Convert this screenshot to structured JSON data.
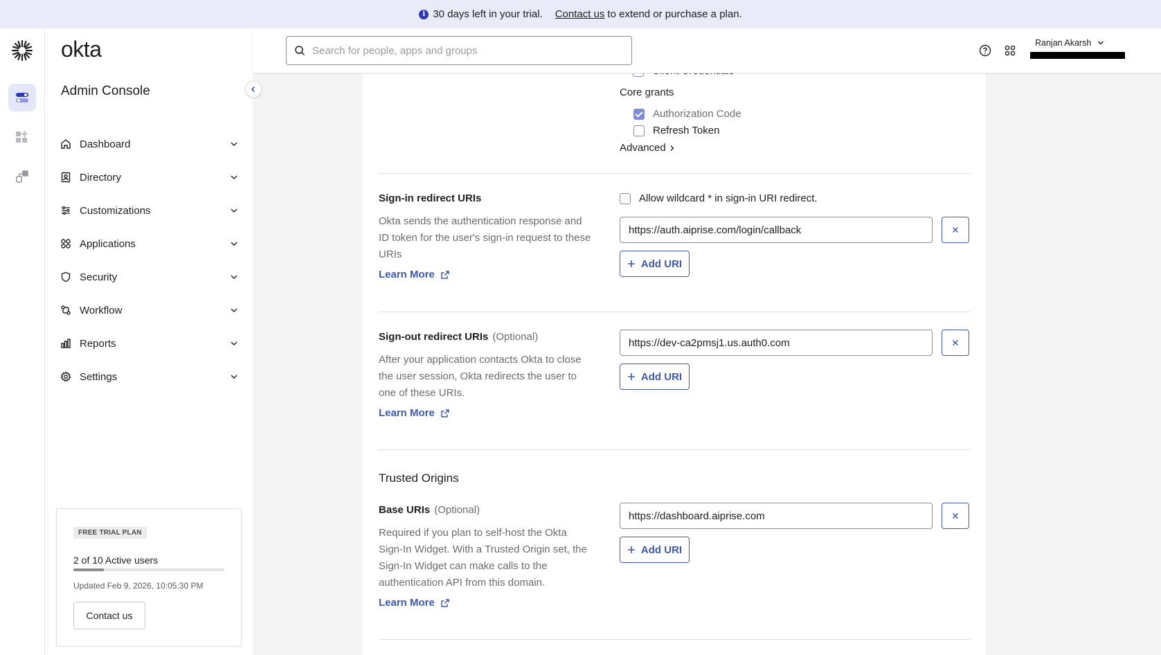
{
  "banner": {
    "message": "30 days left in your trial.",
    "link": "Contact us",
    "suffix": "to extend or purchase a plan."
  },
  "sidebar": {
    "brand": "okta",
    "title": "Admin Console",
    "items": [
      {
        "label": "Dashboard",
        "icon": "home-icon"
      },
      {
        "label": "Directory",
        "icon": "directory-icon"
      },
      {
        "label": "Customizations",
        "icon": "sliders-icon"
      },
      {
        "label": "Applications",
        "icon": "apps-grid-icon"
      },
      {
        "label": "Security",
        "icon": "shield-icon"
      },
      {
        "label": "Workflow",
        "icon": "workflow-icon"
      },
      {
        "label": "Reports",
        "icon": "bar-chart-icon"
      },
      {
        "label": "Settings",
        "icon": "gear-icon"
      }
    ],
    "trial": {
      "badge": "FREE TRIAL PLAN",
      "users": "2 of 10 Active users",
      "users_fraction": 0.2,
      "updated": "Updated Feb 9, 2026, 10:05:30 PM",
      "button": "Contact us"
    }
  },
  "topbar": {
    "search_placeholder": "Search for people, apps and groups",
    "user_name": "Ranjan Akarsh"
  },
  "grants": {
    "cut_label": "Client Credentials",
    "core_label": "Core grants",
    "items": [
      {
        "label": "Authorization Code",
        "checked": true,
        "disabled": true
      },
      {
        "label": "Refresh Token",
        "checked": false,
        "disabled": false
      }
    ],
    "advanced": "Advanced"
  },
  "signin": {
    "title": "Sign-in redirect URIs",
    "description": "Okta sends the authentication response and ID token for the user's sign-in request to these URIs",
    "learn_more": "Learn More",
    "wildcard_label": "Allow wildcard * in sign-in URI redirect.",
    "uri": "https://auth.aiprise.com/login/callback",
    "add_label": "Add URI"
  },
  "signout": {
    "title": "Sign-out redirect URIs",
    "optional": "(Optional)",
    "description": "After your application contacts Okta to close the user session, Okta redirects the user to one of these URIs.",
    "learn_more": "Learn More",
    "uri": "https://dev-ca2pmsj1.us.auth0.com",
    "add_label": "Add URI"
  },
  "trusted": {
    "title": "Trusted Origins",
    "base_title": "Base URIs",
    "optional": "(Optional)",
    "description": "Required if you plan to self-host the Okta Sign-In Widget. With a Trusted Origin set, the Sign-In Widget can make calls to the authentication API from this domain.",
    "learn_more": "Learn More",
    "uri": "https://dashboard.aiprise.com",
    "add_label": "Add URI"
  },
  "colors": {
    "accent": "#3f59a8",
    "banner_bg": "#e9ecf8",
    "checked": "#7f8ad6"
  }
}
